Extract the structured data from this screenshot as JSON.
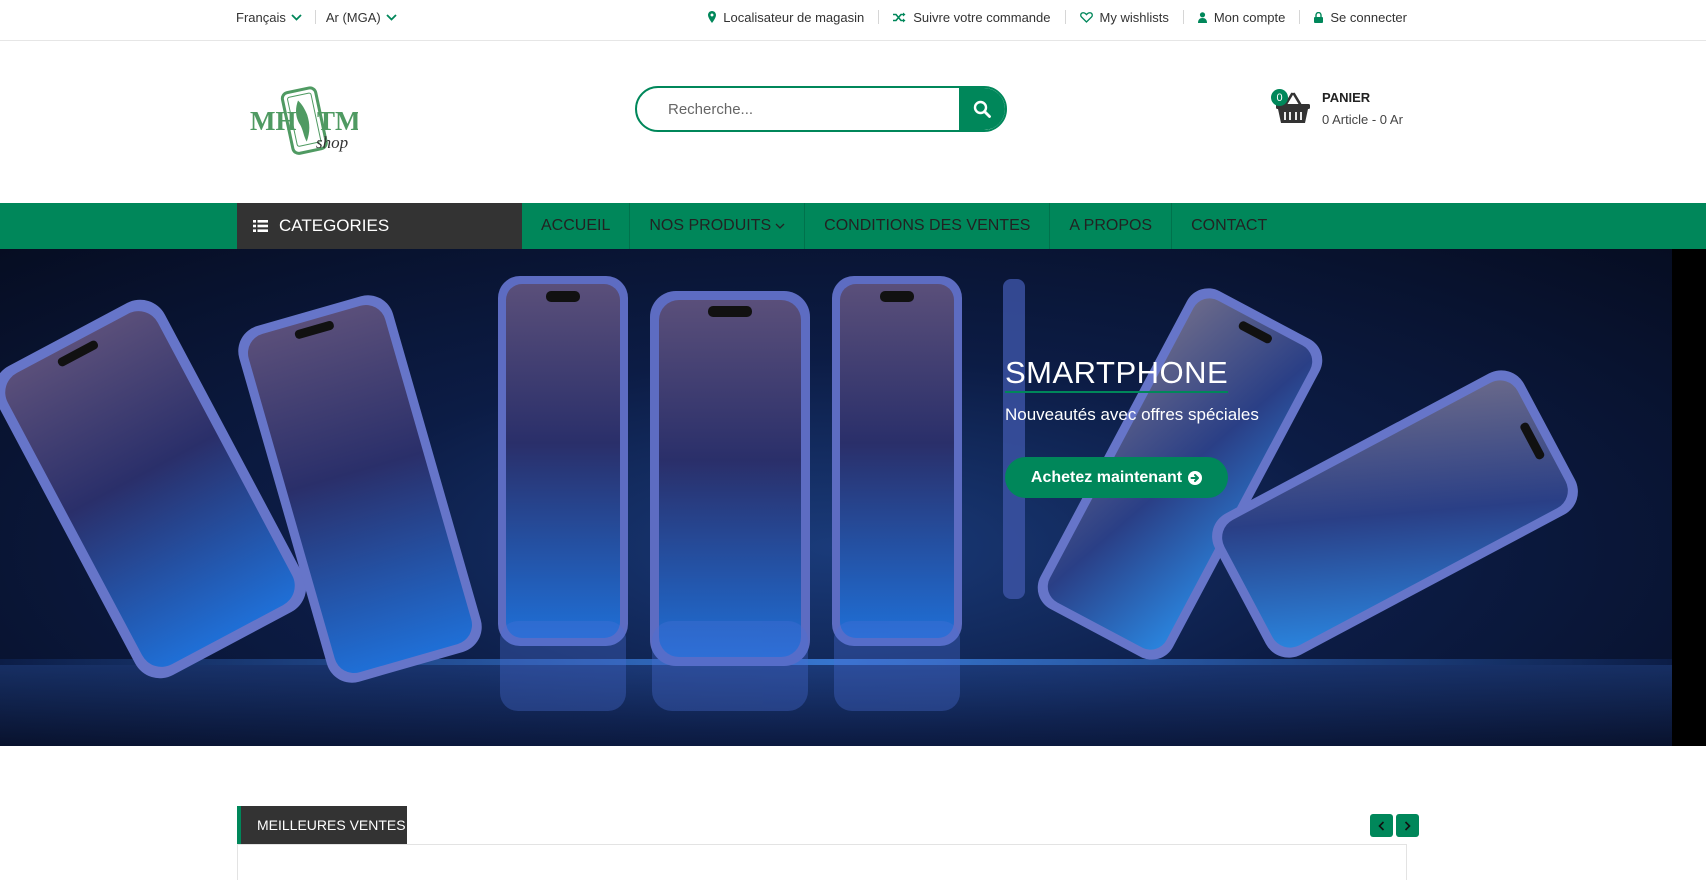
{
  "topbar": {
    "language": "Français",
    "currency": "Ar (MGA)",
    "links": {
      "store_locator": "Localisateur de magasin",
      "track_order": "Suivre votre commande",
      "wishlists": "My wishlists",
      "account": "Mon compte",
      "login": "Se connecter"
    }
  },
  "header": {
    "logo_text": "MH TM shop",
    "search_placeholder": "Recherche...",
    "cart": {
      "count": "0",
      "title": "PANIER",
      "summary": "0 Article - 0 Ar"
    }
  },
  "nav": {
    "categories_label": "CATEGORIES",
    "items": [
      "ACCUEIL",
      "NOS PRODUITS",
      "CONDITIONS DES VENTES",
      "A PROPOS",
      "CONTACT"
    ]
  },
  "hero": {
    "title": "SMARTPHONE",
    "subtitle": "Nouveautés avec offres spéciales",
    "cta": "Achetez maintenant"
  },
  "best_sellers": {
    "label": "MEILLEURES VENTES"
  },
  "colors": {
    "accent": "#00875a",
    "dark": "#333333"
  },
  "icons": [
    "chevron-down-icon",
    "map-marker-icon",
    "shuffle-icon",
    "heart-icon",
    "user-icon",
    "lock-icon",
    "search-icon",
    "basket-icon",
    "list-icon",
    "arrow-circle-right-icon",
    "chevron-left-icon",
    "chevron-right-icon"
  ]
}
